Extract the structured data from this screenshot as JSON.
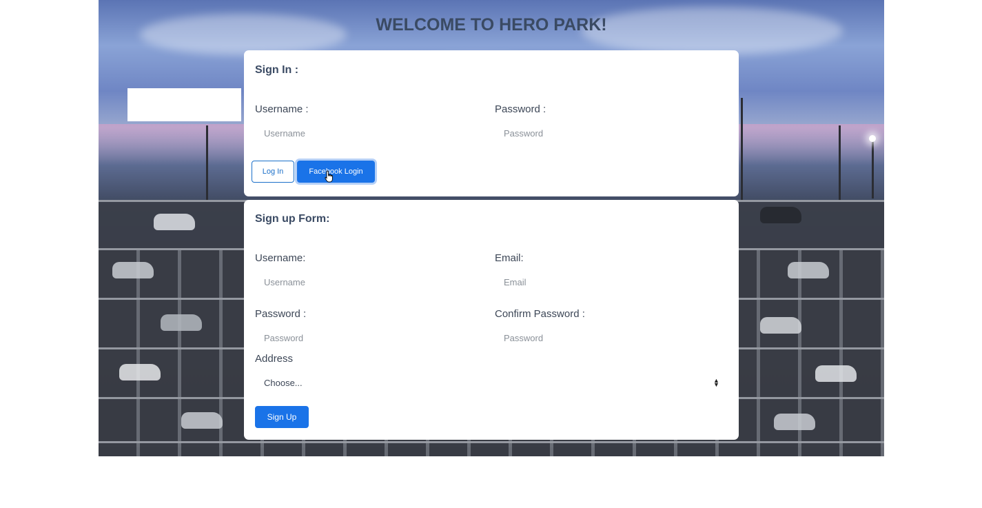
{
  "page_title": "WELCOME TO HERO PARK!",
  "signin": {
    "title": "Sign In :",
    "username_label": "Username :",
    "username_placeholder": "Username",
    "password_label": "Password :",
    "password_placeholder": "Password",
    "login_button": "Log In",
    "facebook_button": "Facebook Login"
  },
  "signup": {
    "title": "Sign up Form:",
    "username_label": "Username:",
    "username_placeholder": "Username",
    "email_label": "Email:",
    "email_placeholder": "Email",
    "password_label": "Password :",
    "password_placeholder": "Password",
    "confirm_label": "Confirm Password :",
    "confirm_placeholder": "Password",
    "address_label": "Address",
    "address_selected": "Choose...",
    "submit_button": "Sign Up"
  },
  "colors": {
    "primary": "#1a73e8",
    "heading": "#3a4a63"
  },
  "icons": {
    "cursor": "hand-pointer-icon",
    "select": "select-arrows-icon"
  }
}
